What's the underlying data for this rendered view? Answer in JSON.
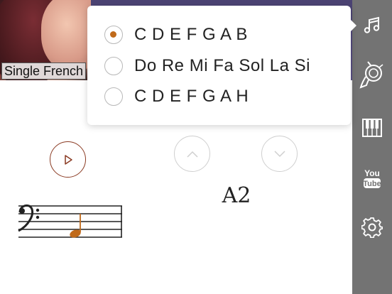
{
  "video": {
    "caption": "Single French"
  },
  "notation_menu": {
    "options": [
      {
        "label": "C D E F G A B",
        "selected": true
      },
      {
        "label": "Do Re Mi Fa Sol La Si",
        "selected": false
      },
      {
        "label": "C D E F G A H",
        "selected": false
      }
    ]
  },
  "trainer": {
    "note_name": "A2",
    "clef": "bass"
  },
  "sidebar": {
    "items": [
      {
        "icon": "music-note-icon"
      },
      {
        "icon": "french-horn-icon"
      },
      {
        "icon": "piano-keyboard-icon"
      },
      {
        "icon": "youtube-icon",
        "label": "You Tube"
      },
      {
        "icon": "gear-icon"
      }
    ]
  },
  "colors": {
    "accent": "#c06a1a",
    "play_border": "#8a3a22",
    "sidebar_bg": "#737373",
    "top_band": "#4b4373"
  }
}
